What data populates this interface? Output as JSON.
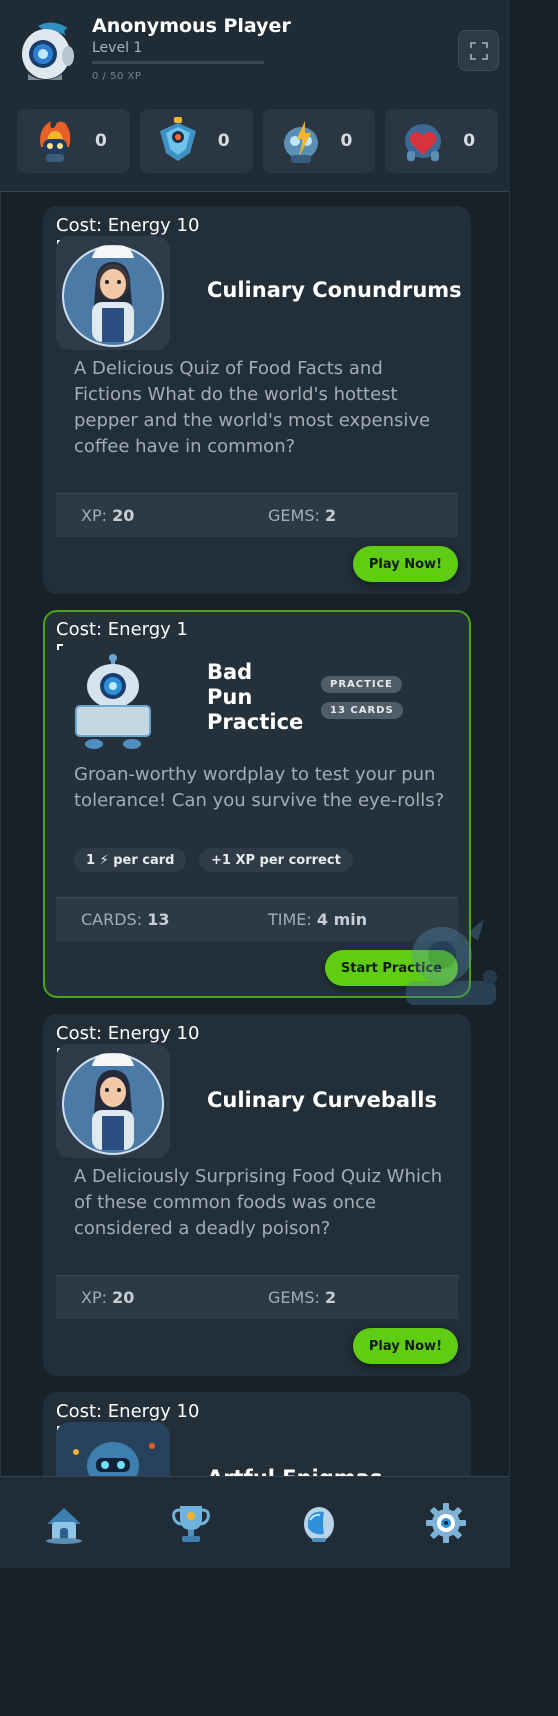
{
  "header": {
    "player_name": "Anonymous Player",
    "level": "Level 1",
    "xp_text": "0 / 50 XP",
    "xp_progress": 0,
    "avatar": "robot-avatar-icon",
    "fullscreen_icon": "fullscreen-icon"
  },
  "stats": [
    {
      "icon": "fire-robot-icon",
      "value": "0"
    },
    {
      "icon": "gem-robot-icon",
      "value": "0"
    },
    {
      "icon": "energy-robot-icon",
      "value": "0"
    },
    {
      "icon": "heart-robot-icon",
      "value": "0"
    }
  ],
  "cards": [
    {
      "cost": "Cost: Energy 10",
      "title": "Culinary Conundrums",
      "description": "A Delicious Quiz of Food Facts and Fictions What do the world's hottest pepper and the world's most expensive coffee have in common?",
      "reward_left_label": "XP:",
      "reward_left_value": "20",
      "reward_right_label": "GEMS:",
      "reward_right_value": "2",
      "button": "Play Now!"
    },
    {
      "cost": "Cost: Energy 1",
      "title_lines": [
        "Bad",
        "Pun",
        "Practice"
      ],
      "badges": [
        "PRACTICE",
        "13 CARDS"
      ],
      "description": "Groan-worthy wordplay to test your pun tolerance! Can you survive the eye-rolls?",
      "pills": [
        "1 ⚡ per card",
        "+1 XP per correct"
      ],
      "reward_left_label": "CARDS:",
      "reward_left_value": "13",
      "reward_right_label": "TIME:",
      "reward_right_value": "4 min",
      "button": "Start Practice"
    },
    {
      "cost": "Cost: Energy 10",
      "title": "Culinary Curveballs",
      "description": "A Deliciously Surprising Food Quiz Which of these common foods was once considered a deadly poison?",
      "reward_left_label": "XP:",
      "reward_left_value": "20",
      "reward_right_label": "GEMS:",
      "reward_right_value": "2",
      "button": "Play Now!"
    },
    {
      "cost": "Cost: Energy 10",
      "title": "Artful Enigmas"
    }
  ],
  "nav": [
    {
      "icon": "home-icon"
    },
    {
      "icon": "trophy-icon"
    },
    {
      "icon": "helmet-icon"
    },
    {
      "icon": "settings-gear-icon"
    }
  ],
  "colors": {
    "background": "#16212a",
    "card": "#222e38",
    "accent_green": "#5fce12",
    "featured_border": "#4fa31c"
  }
}
